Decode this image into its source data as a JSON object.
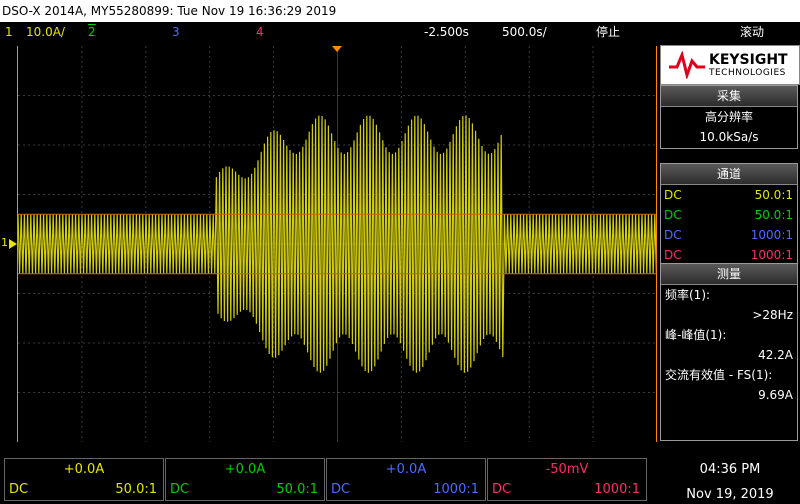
{
  "title_bar": {
    "text": "DSO-X 2014A, MY55280899: Tue Nov 19 16:36:29 2019"
  },
  "status_bar": {
    "ch1_number": "1",
    "ch1_scale": "10.0A/",
    "ch2_number": "2",
    "ch3_number": "3",
    "ch4_number": "4",
    "delay": "-2.500s",
    "timebase": "500.0s/",
    "run_state": "停止",
    "mode": "滚动"
  },
  "brand": {
    "line1": "KEYSIGHT",
    "line2": "TECHNOLOGIES"
  },
  "acquisition": {
    "header": "采集",
    "mode": "高分辨率",
    "rate": "10.0kSa/s"
  },
  "channels_panel": {
    "header": "通道",
    "rows": [
      {
        "coupling": "DC",
        "probe": "50.0:1",
        "color": "#e6e600"
      },
      {
        "coupling": "DC",
        "probe": "50.0:1",
        "color": "#00d000"
      },
      {
        "coupling": "DC",
        "probe": "1000:1",
        "color": "#4a6cff"
      },
      {
        "coupling": "DC",
        "probe": "1000:1",
        "color": "#ff2b6b"
      }
    ]
  },
  "measure": {
    "header": "测量",
    "items": [
      {
        "label": "频率(1):",
        "value": ">28Hz"
      },
      {
        "label": "峰-峰值(1):",
        "value": "42.2A"
      },
      {
        "label": "交流有效值 - FS(1):",
        "value": "9.69A"
      }
    ]
  },
  "bottom_channels": [
    {
      "offset": "+0.0A",
      "coupling": "DC",
      "probe": "50.0:1",
      "color": "#e6e600"
    },
    {
      "offset": "+0.0A",
      "coupling": "DC",
      "probe": "50.0:1",
      "color": "#00d000"
    },
    {
      "offset": "+0.0A",
      "coupling": "DC",
      "probe": "1000:1",
      "color": "#4a6cff"
    },
    {
      "offset": "-50mV",
      "coupling": "DC",
      "probe": "1000:1",
      "color": "#ff2b6b"
    }
  ],
  "clock": {
    "time": "04:36 PM",
    "date": "Nov 19, 2019"
  },
  "ground_marker": "1",
  "trace": {
    "color": "#d4cc10",
    "grid_divisions": {
      "x": 10,
      "y": 8
    },
    "segments": [
      {
        "from_div": 0.0,
        "to_div": 3.1,
        "amplitude_div": 0.6
      },
      {
        "from_div": 3.1,
        "to_div": 7.6,
        "amplitude_div": 2.6
      },
      {
        "from_div": 7.6,
        "to_div": 10.0,
        "amplitude_div": 0.6
      }
    ]
  }
}
